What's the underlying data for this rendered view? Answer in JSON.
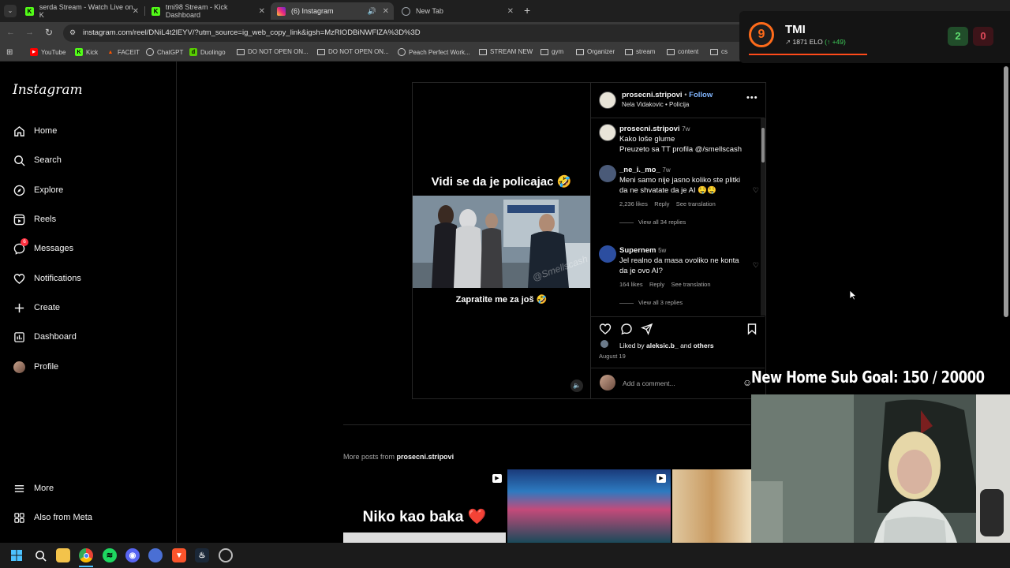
{
  "browser": {
    "tabs": [
      {
        "title": "serda Stream - Watch Live on K",
        "icon": "kick-icon",
        "color": "#53fc18"
      },
      {
        "title": "tmi98 Stream - Kick Dashboard",
        "icon": "kick-icon",
        "color": "#53fc18"
      },
      {
        "title": "(6) Instagram",
        "icon": "instagram-icon",
        "color": "#e1306c"
      },
      {
        "title": "New Tab",
        "icon": "chrome-icon",
        "color": "#9aa0a6"
      }
    ],
    "url": "instagram.com/reel/DNiL4t2lEYV/?utm_source=ig_web_copy_link&igsh=MzRlODBiNWFlZA%3D%3D",
    "bookmarks": [
      "YouTube",
      "Kick",
      "FACEIT",
      "ChatGPT",
      "Duolingo",
      "DO NOT OPEN ON...",
      "DO NOT OPEN ON...",
      "Peach Perfect Work...",
      "STREAM NEW",
      "gym",
      "Organizer",
      "stream",
      "content",
      "cs"
    ]
  },
  "sidebar": {
    "logo": "Instagram",
    "items": [
      {
        "label": "Home",
        "icon": "home-icon"
      },
      {
        "label": "Search",
        "icon": "search-icon"
      },
      {
        "label": "Explore",
        "icon": "compass-icon"
      },
      {
        "label": "Reels",
        "icon": "reels-icon"
      },
      {
        "label": "Messages",
        "icon": "messenger-icon",
        "badge": "6"
      },
      {
        "label": "Notifications",
        "icon": "heart-icon"
      },
      {
        "label": "Create",
        "icon": "plus-icon"
      },
      {
        "label": "Dashboard",
        "icon": "dashboard-icon"
      },
      {
        "label": "Profile",
        "icon": "avatar-icon"
      }
    ],
    "more": "More",
    "meta": "Also from Meta"
  },
  "reel": {
    "video": {
      "caption_top": "Vidi se da je policajac 🤣",
      "caption_bottom": "Zapratite me za još 🤣",
      "watermark": "@Smellscash"
    },
    "header": {
      "username": "prosecni.stripovi",
      "follow": "Follow",
      "subtitle": "Nela Vidakovic • Policija"
    },
    "post_caption": {
      "username": "prosecni.stripovi",
      "age": "7w",
      "line1": "Kako loše glume",
      "line2": "Preuzeto sa TT profila @/smellscash"
    },
    "comments": [
      {
        "username": "_ne_i._mo_",
        "age": "7w",
        "text": "Meni samo nije jasno koliko ste plitki da ne shvatate da je AI 🤤🤤",
        "likes": "2,236 likes",
        "reply": "Reply",
        "translate": "See translation",
        "view_replies": "View all 34 replies"
      },
      {
        "username": "Supernem",
        "age": "5w",
        "text": "Jel realno da masa ovoliko ne konta da je ovo AI?",
        "likes": "164 likes",
        "reply": "Reply",
        "translate": "See translation",
        "view_replies": "View all 3 replies"
      }
    ],
    "liked_by": {
      "prefix": "Liked by",
      "user": "aleksic.b_",
      "and": "and",
      "others": "others"
    },
    "date": "August 19",
    "add_comment_placeholder": "Add a comment..."
  },
  "more_posts": {
    "prefix": "More posts from",
    "user": "prosecni.stripovi",
    "thumb1_text": "Niko kao baka ❤️"
  },
  "overlay": {
    "tmi_level": "9",
    "tmi_name": "TMI",
    "tmi_elo": "1871 ELO",
    "tmi_delta": "(↑ +49)",
    "wins": "2",
    "losses": "0",
    "goal_text": "New Home Sub Goal:  150 / 20000"
  },
  "colors": {
    "ig_blue": "#0095f6",
    "follow_blue": "#82b6ff",
    "badge_red": "#ff3040",
    "win_green": "#2f8a3d",
    "loss_red": "#7a1f2a"
  }
}
